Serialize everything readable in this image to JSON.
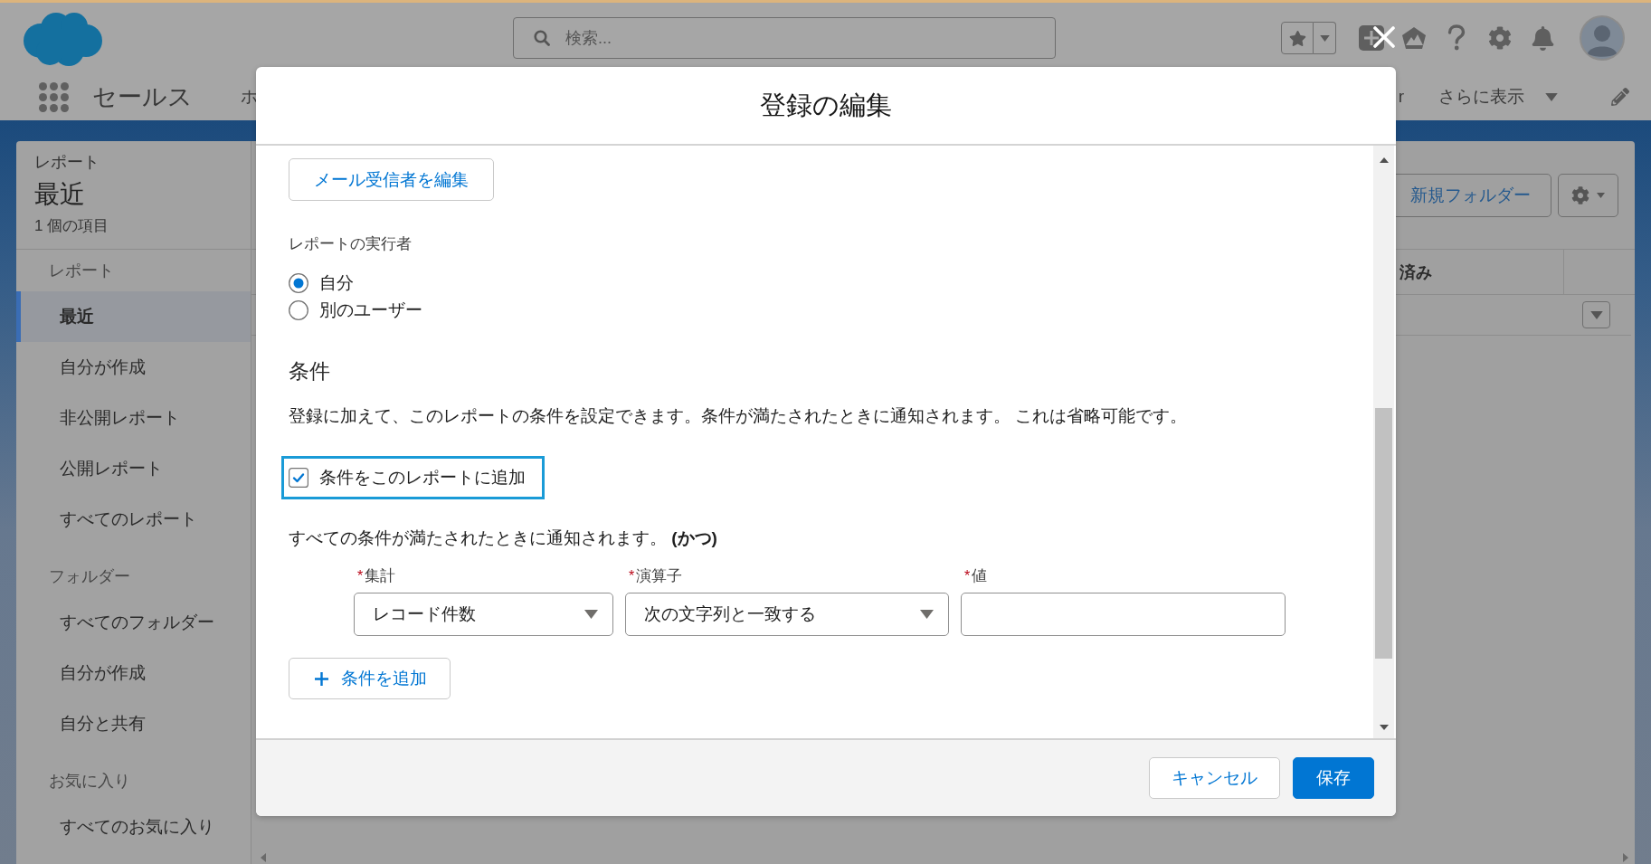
{
  "header": {
    "search": {
      "placeholder": "検索..."
    }
  },
  "nav": {
    "app_name": "セールス",
    "tabs": [
      {
        "label": "ホ"
      },
      {
        "label": "r"
      }
    ],
    "more_label": "さらに表示"
  },
  "sidebar": {
    "object_label": "レポート",
    "title": "最近",
    "item_count": "1 個の項目",
    "sections": [
      {
        "title": "レポート",
        "items": [
          {
            "label": "最近",
            "selected": true
          },
          {
            "label": "自分が作成",
            "selected": false
          },
          {
            "label": "非公開レポート",
            "selected": false
          },
          {
            "label": "公開レポート",
            "selected": false
          },
          {
            "label": "すべてのレポート",
            "selected": false
          }
        ]
      },
      {
        "title": "フォルダー",
        "items": [
          {
            "label": "すべてのフォルダー",
            "selected": false
          },
          {
            "label": "自分が作成",
            "selected": false
          },
          {
            "label": "自分と共有",
            "selected": false
          }
        ]
      },
      {
        "title": "お気に入り",
        "items": [
          {
            "label": "すべてのお気に入り",
            "selected": false
          }
        ]
      }
    ]
  },
  "list_view": {
    "new_folder_button": "新規フォルダー",
    "columns": [
      {
        "label": "済み"
      }
    ]
  },
  "modal": {
    "title": "登録の編集",
    "edit_recipients_button": "メール受信者を編集",
    "run_as": {
      "label": "レポートの実行者",
      "options": [
        {
          "label": "自分",
          "selected": true
        },
        {
          "label": "別のユーザー",
          "selected": false
        }
      ]
    },
    "conditions": {
      "heading": "条件",
      "description": "登録に加えて、このレポートの条件を設定できます。条件が満たされたときに通知されます。 これは省略可能です。",
      "add_checkbox": {
        "label": "条件をこのレポートに追加",
        "checked": true,
        "highlighted": true
      },
      "logic_text": "すべての条件が満たされたときに通知されます。 **(かつ)**",
      "fields": [
        {
          "kind": "select",
          "required_mark": "*",
          "label": "集計",
          "value": "レコード件数"
        },
        {
          "kind": "select",
          "required_mark": "*",
          "label": "演算子",
          "value": "次の文字列と一致する"
        },
        {
          "kind": "input",
          "required_mark": "*",
          "label": "値"
        }
      ],
      "add_condition_button": "条件を追加"
    },
    "footer": {
      "buttons": [
        {
          "kind": "neutral",
          "label": "キャンセル"
        },
        {
          "kind": "brand",
          "label": "保存"
        }
      ]
    }
  }
}
